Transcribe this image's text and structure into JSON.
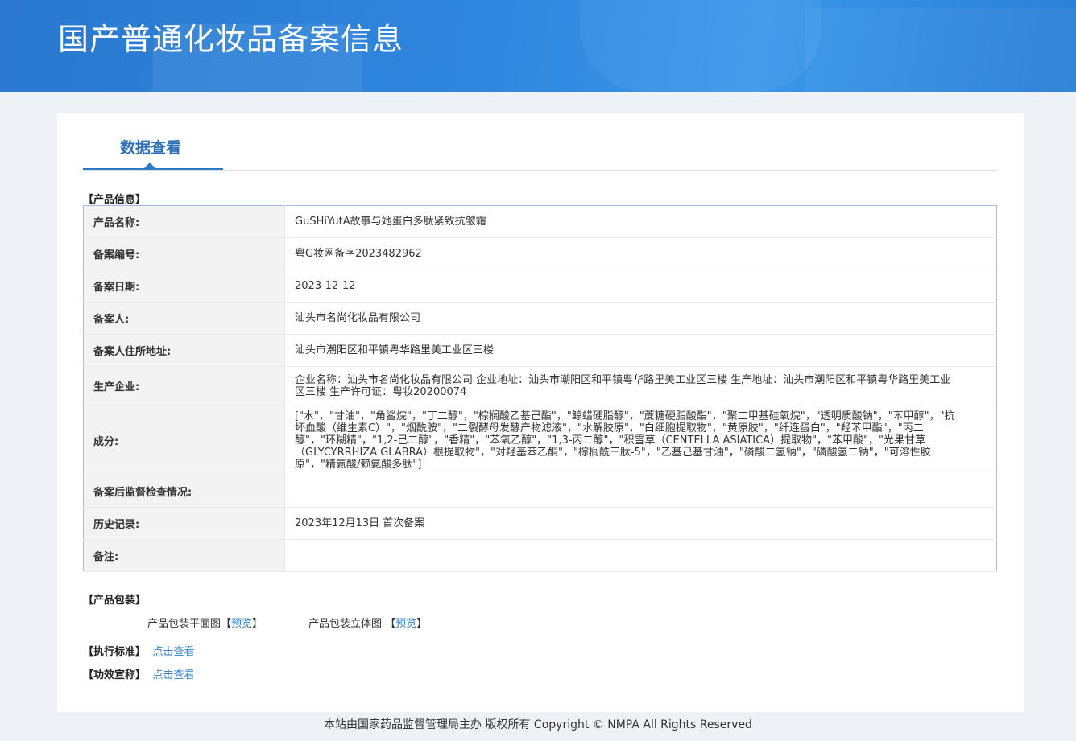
{
  "header": {
    "title": "国产普通化妆品备案信息"
  },
  "tabs": [
    {
      "label": "数据查看"
    }
  ],
  "sections": {
    "product_info": "【产品信息】",
    "package": "【产品包装】",
    "standard": "【执行标准】",
    "efficacy": "【功效宣称】"
  },
  "rows": [
    {
      "label": "产品名称:",
      "value": "GuSHiYutA故事与她蛋白多肽紧致抗皱霜"
    },
    {
      "label": "备案编号:",
      "value": "粤G妆网备字2023482962"
    },
    {
      "label": "备案日期:",
      "value": "2023-12-12"
    },
    {
      "label": "备案人:",
      "value": "汕头市名尚化妆品有限公司"
    },
    {
      "label": "备案人住所地址:",
      "value": "汕头市潮阳区和平镇粤华路里美工业区三楼"
    },
    {
      "label": "生产企业:",
      "value": "企业名称：汕头市名尚化妆品有限公司 企业地址：汕头市潮阳区和平镇粤华路里美工业区三楼 生产地址：汕头市潮阳区和平镇粤华路里美工业区三楼 生产许可证：粤妆20200074"
    },
    {
      "label": "成分:",
      "value": "[\"水\"，\"甘油\"，\"角鲨烷\"，\"丁二醇\"，\"棕榈酸乙基己酯\"，\"鲸蜡硬脂醇\"，\"蔗糖硬脂酸酯\"，\"聚二甲基硅氧烷\"，\"透明质酸钠\"，\"苯甲醇\"，\"抗坏血酸（维生素C）\"，\"烟酰胺\"，\"二裂酵母发酵产物滤液\"，\"水解胶原\"，\"白细胞提取物\"，\"黄原胶\"，\"纤连蛋白\"，\"羟苯甲酯\"，\"丙二醇\"，\"环糊精\"，\"1,2-己二醇\"，\"香精\"，\"苯氧乙醇\"，\"1,3-丙二醇\"，\"积雪草（CENTELLA ASIATICA）提取物\"，\"苯甲酸\"，\"光果甘草（GLYCYRRHIZA GLABRA）根提取物\"，\"对羟基苯乙酮\"，\"棕榈酰三肽-5\"，\"乙基己基甘油\"，\"磷酸二氢钠\"，\"磷酸氢二钠\"，\"可溶性胶原\"，\"精氨酸/赖氨酸多肽\"]"
    },
    {
      "label": "备案后监督检查情况:",
      "value": ""
    },
    {
      "label": "历史记录:",
      "value": "2023年12月13日 首次备案"
    },
    {
      "label": "备注:",
      "value": ""
    }
  ],
  "package": {
    "flat_label": "产品包装平面图",
    "solid_label": "产品包装立体图",
    "bracket_open": "【",
    "bracket_close": "】",
    "preview": "预览"
  },
  "links": {
    "view": "点击查看"
  },
  "footer": {
    "text": "本站由国家药品监督管理局主办 版权所有 Copyright © NMPA All Rights Reserved"
  }
}
